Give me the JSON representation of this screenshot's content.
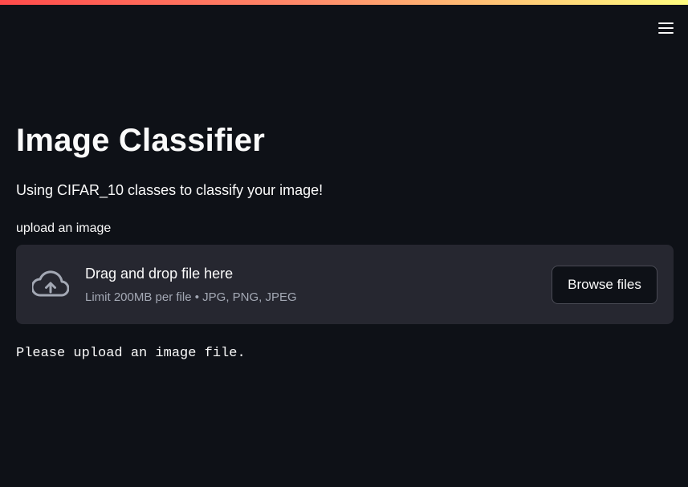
{
  "header": {
    "menu_icon": "hamburger-menu-icon",
    "decoration_colors": [
      "#ff4b4b",
      "#fffd80"
    ]
  },
  "main": {
    "title": "Image Classifier",
    "subtitle": "Using CIFAR_10 classes to classify your image!",
    "uploader": {
      "label": "upload an image",
      "icon": "cloud-upload-icon",
      "dropzone_text": "Drag and drop file here",
      "limits_text": "Limit 200MB per file • JPG, PNG, JPEG",
      "browse_label": "Browse files"
    },
    "status_message": "Please upload an image file."
  },
  "colors": {
    "background": "#0e1117",
    "dropzone_background": "#262730",
    "text": "#fafafa",
    "muted_text": "#a3a8b4"
  }
}
